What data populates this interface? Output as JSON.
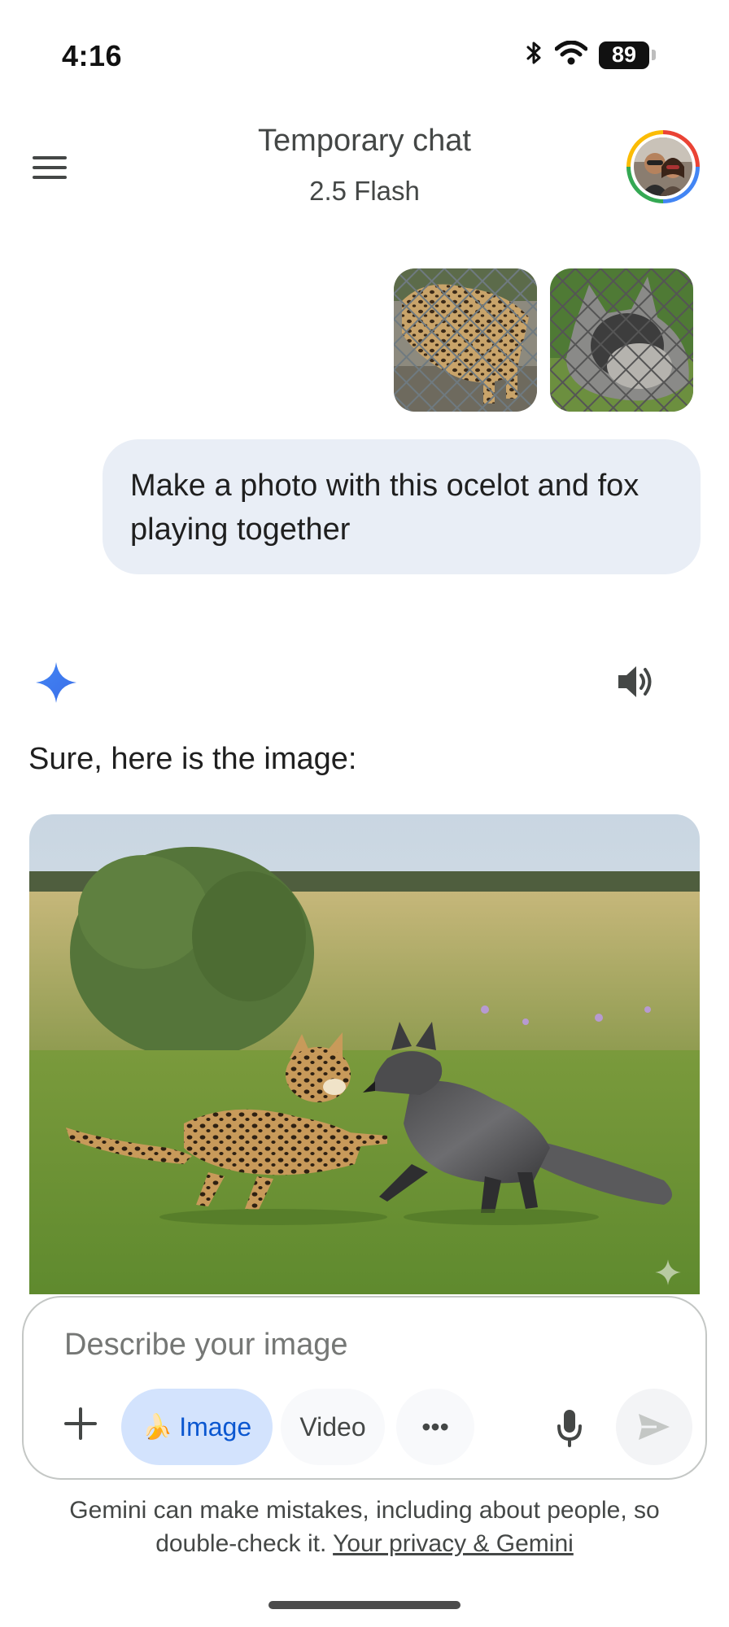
{
  "status_bar": {
    "time": "4:16",
    "battery_level": "89",
    "icons": [
      "bluetooth-icon",
      "wifi-icon",
      "battery-icon"
    ]
  },
  "header": {
    "title": "Temporary chat",
    "model": "2.5 Flash",
    "menu_icon": "hamburger-menu-icon",
    "avatar_icon": "user-avatar"
  },
  "conversation": {
    "user_attachments": [
      {
        "subject": "ocelot behind chain-link fence"
      },
      {
        "subject": "silver fox behind chain-link fence"
      }
    ],
    "user_message": "Make a photo with this ocelot and fox playing together",
    "response": {
      "intro": "Sure, here is the image:",
      "logo_icon": "gemini-sparkle-icon",
      "speaker_icon": "speaker-icon",
      "image_subject": "ocelot and fox playing in a grassy field"
    }
  },
  "composer": {
    "placeholder": "Describe your image",
    "value": "",
    "chips": {
      "image": "Image",
      "video": "Video",
      "more": "•••"
    },
    "icons": [
      "plus-icon",
      "banana-icon",
      "mic-icon",
      "send-icon"
    ]
  },
  "footer": {
    "disclaimer": "Gemini can make mistakes, including about people, so double-check it.",
    "privacy_link": "Your privacy & Gemini"
  },
  "colors": {
    "bubble": "#e9eef6",
    "accent_blue": "#0b57d0",
    "chip_active": "#d3e3fd",
    "sparkle": "#4285f4"
  }
}
